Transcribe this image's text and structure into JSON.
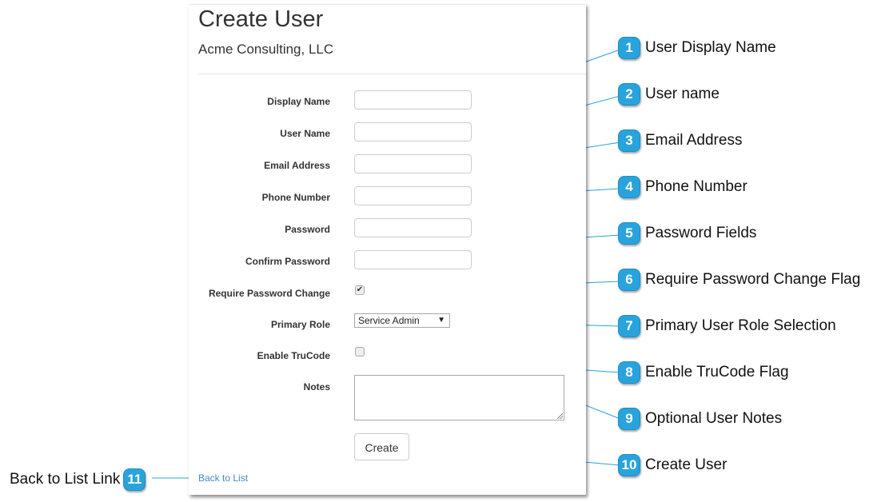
{
  "form": {
    "title": "Create User",
    "subtitle": "Acme Consulting, LLC",
    "fields": {
      "display_name": {
        "label": "Display Name",
        "value": ""
      },
      "user_name": {
        "label": "User Name",
        "value": ""
      },
      "email": {
        "label": "Email Address",
        "value": ""
      },
      "phone": {
        "label": "Phone Number",
        "value": ""
      },
      "password": {
        "label": "Password",
        "value": ""
      },
      "confirm_password": {
        "label": "Confirm Password",
        "value": ""
      },
      "require_pw_change": {
        "label": "Require Password Change",
        "checked": true,
        "glyph": "✔"
      },
      "primary_role": {
        "label": "Primary Role",
        "selected": "Service Admin",
        "arrow": "▼"
      },
      "enable_trucode": {
        "label": "Enable TruCode",
        "checked": false
      },
      "notes": {
        "label": "Notes",
        "value": ""
      }
    },
    "create_button": "Create",
    "back_link": "Back to List"
  },
  "annotations": {
    "color": "#29a3dc",
    "items": [
      {
        "number": "1",
        "text": "User Display Name"
      },
      {
        "number": "2",
        "text": "User name"
      },
      {
        "number": "3",
        "text": "Email Address"
      },
      {
        "number": "4",
        "text": "Phone Number"
      },
      {
        "number": "5",
        "text": "Password Fields"
      },
      {
        "number": "6",
        "text": "Require Password Change Flag"
      },
      {
        "number": "7",
        "text": "Primary User Role Selection"
      },
      {
        "number": "8",
        "text": "Enable TruCode Flag"
      },
      {
        "number": "9",
        "text": "Optional User Notes"
      },
      {
        "number": "10",
        "text": "Create User"
      },
      {
        "number": "11",
        "text": "Back to List Link"
      }
    ]
  }
}
